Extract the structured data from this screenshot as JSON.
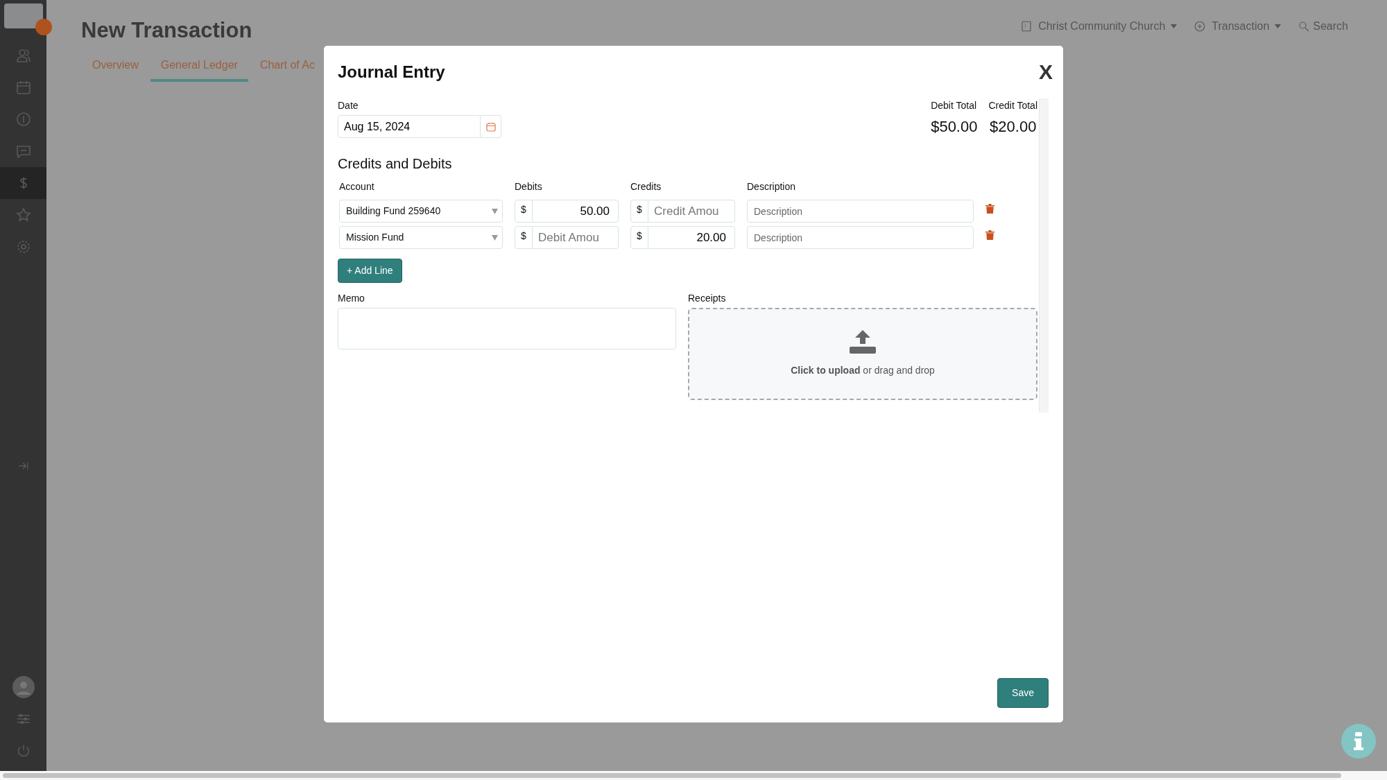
{
  "sidebar": {
    "items": [
      {
        "selected": false
      },
      {
        "selected": false
      },
      {
        "selected": false
      },
      {
        "selected": false
      },
      {
        "selected": true
      },
      {
        "selected": false
      },
      {
        "selected": false
      }
    ]
  },
  "topbar": {
    "organization": "Christ Community Church",
    "context": "Transaction",
    "search": "Search"
  },
  "page": {
    "title": "New Transaction",
    "tabs": [
      {
        "label": "Overview",
        "selected": false
      },
      {
        "label": "General Ledger",
        "selected": true
      },
      {
        "label": "Chart of Ac",
        "selected": false
      }
    ]
  },
  "modal": {
    "title": "Journal Entry",
    "close": "X",
    "date": {
      "label": "Date",
      "value": "Aug 15, 2024"
    },
    "totals": [
      {
        "label": "Debit Total",
        "value": "$50.00"
      },
      {
        "label": "Credit Total",
        "value": "$20.00"
      }
    ],
    "section_title": "Credits and Debits",
    "columns": [
      "Account",
      "Debits",
      "Credits",
      "Description"
    ],
    "lines": [
      {
        "account": "Building Fund 259640",
        "debit": {
          "currency": "$",
          "value": "50.00"
        },
        "credit": {
          "currency": "$",
          "placeholder": "Credit Amou"
        },
        "description": {
          "placeholder": "Description"
        }
      },
      {
        "account": "Mission Fund",
        "debit": {
          "currency": "$",
          "placeholder": "Debit Amou"
        },
        "credit": {
          "currency": "$",
          "value": "20.00"
        },
        "description": {
          "placeholder": "Description"
        }
      }
    ],
    "add_line": "+ Add Line",
    "memo": {
      "label": "Memo"
    },
    "receipts": {
      "label": "Receipts",
      "prompt": "**Click to upload** or drag and drop"
    },
    "save": "Save"
  }
}
